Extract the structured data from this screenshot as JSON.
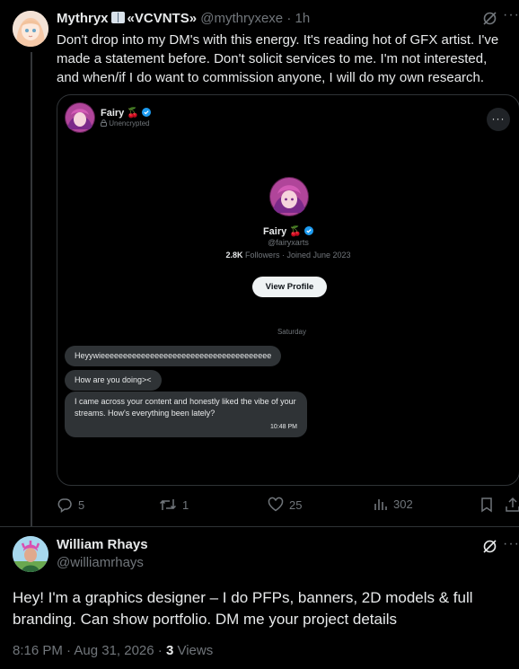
{
  "post1": {
    "author_name": "Mythryx",
    "author_name_suffix": "«VCVNTS»",
    "handle": "@mythryxexe",
    "separator": "·",
    "time": "1h",
    "more": "···",
    "text": "Don't drop into my DM's with this energy. It's reading hot of GFX artist. I've made a statement before. Don't solicit services to me. I'm not interested, and when/if I do want to commission anyone, I will do my own research.",
    "dm_screenshot": {
      "header_name": "Fairy 🍒",
      "header_status": "Unencrypted",
      "more": "···",
      "profile_name": "Fairy 🍒",
      "profile_handle": "@fairyxarts",
      "followers_count": "2.8K",
      "followers_rest": "Followers · Joined June 2023",
      "view_profile_label": "View Profile",
      "day_label": "Saturday",
      "messages": [
        "Heyywieeeeeeeeeeeeeeeeeeeeeeeeeeeeeeeeeeeeee",
        "How are you doing><",
        "I came across your content and honestly liked the vibe of your streams. How's everything been lately?"
      ],
      "last_time": "10:48 PM"
    },
    "actions": {
      "replies": "5",
      "reposts": "1",
      "likes": "25",
      "views": "302"
    }
  },
  "post2": {
    "author_name": "William Rhays",
    "handle": "@williamrhays",
    "more": "···",
    "text": "Hey! I'm a graphics designer – I do PFPs, banners, 2D models & full branding. Can show portfolio. DM me your project details",
    "timestamp": "8:16 PM · Aug 31, 2026 · ",
    "views_count": "3",
    "views_label": " Views"
  },
  "colors": {
    "background": "#000000",
    "text_primary": "#e7e9ea",
    "text_secondary": "#71767b",
    "border": "#2f3336",
    "verified_blue": "#1d9bf0"
  }
}
